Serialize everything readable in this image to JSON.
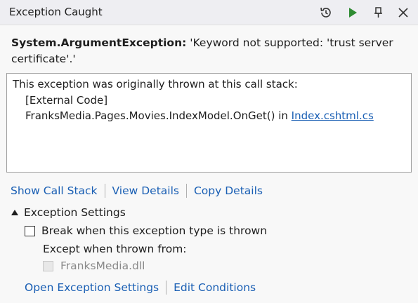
{
  "window": {
    "title": "Exception Caught",
    "icons": [
      "history-icon",
      "continue-icon",
      "pin-icon",
      "close-icon"
    ]
  },
  "exception": {
    "type": "System.ArgumentException:",
    "message": " 'Keyword not supported: 'trust server certificate'.'"
  },
  "call_stack": {
    "intro": "This exception was originally thrown at this call stack:",
    "frame1": "[External Code]",
    "frame2_text": "FranksMedia.Pages.Movies.IndexModel.OnGet() in ",
    "frame2_link": "Index.cshtml.cs"
  },
  "actions": {
    "show_call_stack": "Show Call Stack",
    "view_details": "View Details",
    "copy_details": "Copy Details"
  },
  "exception_settings": {
    "header": "Exception Settings",
    "break_label": "Break when this exception type is thrown",
    "except_label": "Except when thrown from:",
    "module": "FranksMedia.dll",
    "open_settings": "Open Exception Settings",
    "edit_conditions": "Edit Conditions"
  },
  "colors": {
    "link": "#1a5fb4",
    "continue": "#2e8b32"
  }
}
